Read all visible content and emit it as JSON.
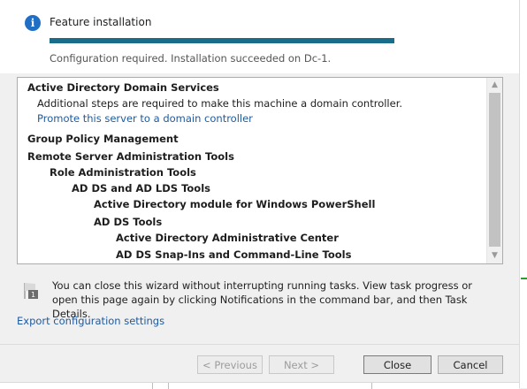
{
  "header": {
    "icon": "info-icon",
    "title": "Feature installation",
    "progress_fraction": 1.0,
    "progress_color": "#1a6d8a",
    "status": "Configuration required. Installation succeeded on Dc-1."
  },
  "results": {
    "rows": [
      {
        "text": "Active Directory Domain Services",
        "indent": 0,
        "style": "bold"
      },
      {
        "text": "Additional steps are required to make this machine a domain controller.",
        "indent": 1,
        "style": "normal"
      },
      {
        "text": "Promote this server to a domain controller",
        "indent": 1,
        "style": "link"
      },
      {
        "text": "Group Policy Management",
        "indent": 0,
        "style": "bold"
      },
      {
        "text": "Remote Server Administration Tools",
        "indent": 0,
        "style": "bold"
      },
      {
        "text": "Role Administration Tools",
        "indent": 1,
        "style": "bold"
      },
      {
        "text": "AD DS and AD LDS Tools",
        "indent": 2,
        "style": "bold"
      },
      {
        "text": "Active Directory module for Windows PowerShell",
        "indent": 3,
        "style": "bold"
      },
      {
        "text": "AD DS Tools",
        "indent": 3,
        "style": "bold"
      },
      {
        "text": "Active Directory Administrative Center",
        "indent": 4,
        "style": "bold"
      },
      {
        "text": "AD DS Snap-Ins and Command-Line Tools",
        "indent": 4,
        "style": "bold"
      }
    ]
  },
  "note": {
    "icon": "flag-icon",
    "text": "You can close this wizard without interrupting running tasks. View task progress or open this page again by clicking Notifications in the command bar, and then Task Details."
  },
  "export_link": "Export configuration settings",
  "buttons": {
    "previous": "< Previous",
    "next": "Next >",
    "close": "Close",
    "cancel": "Cancel"
  }
}
